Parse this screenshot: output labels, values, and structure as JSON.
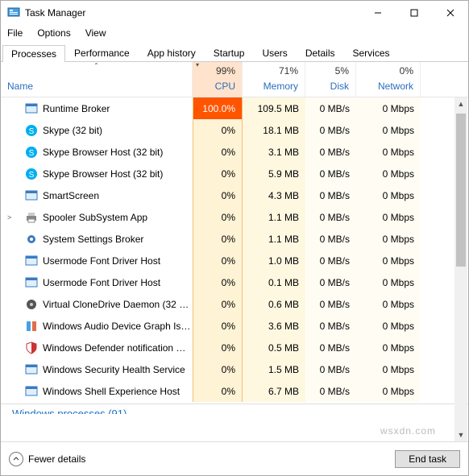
{
  "window": {
    "title": "Task Manager",
    "buttons": {
      "min": "—",
      "max": "☐",
      "close": "✕"
    }
  },
  "menu": [
    "File",
    "Options",
    "View"
  ],
  "tabs": [
    "Processes",
    "Performance",
    "App history",
    "Startup",
    "Users",
    "Details",
    "Services"
  ],
  "active_tab": 0,
  "columns": {
    "name": "Name",
    "cpu": {
      "pct": "99%",
      "label": "CPU"
    },
    "mem": {
      "pct": "71%",
      "label": "Memory"
    },
    "disk": {
      "pct": "5%",
      "label": "Disk"
    },
    "net": {
      "pct": "0%",
      "label": "Network"
    }
  },
  "sort_column": "cpu",
  "rows": [
    {
      "icon": "app",
      "name": "Runtime Broker",
      "cpu": "100.0%",
      "mem": "109.5 MB",
      "disk": "0 MB/s",
      "net": "0 Mbps",
      "hot": true
    },
    {
      "icon": "skype",
      "name": "Skype (32 bit)",
      "cpu": "0%",
      "mem": "18.1 MB",
      "disk": "0 MB/s",
      "net": "0 Mbps"
    },
    {
      "icon": "skype",
      "name": "Skype Browser Host (32 bit)",
      "cpu": "0%",
      "mem": "3.1 MB",
      "disk": "0 MB/s",
      "net": "0 Mbps"
    },
    {
      "icon": "skype",
      "name": "Skype Browser Host (32 bit)",
      "cpu": "0%",
      "mem": "5.9 MB",
      "disk": "0 MB/s",
      "net": "0 Mbps"
    },
    {
      "icon": "app",
      "name": "SmartScreen",
      "cpu": "0%",
      "mem": "4.3 MB",
      "disk": "0 MB/s",
      "net": "0 Mbps"
    },
    {
      "icon": "printer",
      "name": "Spooler SubSystem App",
      "cpu": "0%",
      "mem": "1.1 MB",
      "disk": "0 MB/s",
      "net": "0 Mbps",
      "expand": true
    },
    {
      "icon": "gear",
      "name": "System Settings Broker",
      "cpu": "0%",
      "mem": "1.1 MB",
      "disk": "0 MB/s",
      "net": "0 Mbps"
    },
    {
      "icon": "app",
      "name": "Usermode Font Driver Host",
      "cpu": "0%",
      "mem": "1.0 MB",
      "disk": "0 MB/s",
      "net": "0 Mbps"
    },
    {
      "icon": "app",
      "name": "Usermode Font Driver Host",
      "cpu": "0%",
      "mem": "0.1 MB",
      "disk": "0 MB/s",
      "net": "0 Mbps"
    },
    {
      "icon": "disc",
      "name": "Virtual CloneDrive Daemon (32 …",
      "cpu": "0%",
      "mem": "0.6 MB",
      "disk": "0 MB/s",
      "net": "0 Mbps"
    },
    {
      "icon": "audio",
      "name": "Windows Audio Device Graph Is…",
      "cpu": "0%",
      "mem": "3.6 MB",
      "disk": "0 MB/s",
      "net": "0 Mbps"
    },
    {
      "icon": "shield",
      "name": "Windows Defender notification …",
      "cpu": "0%",
      "mem": "0.5 MB",
      "disk": "0 MB/s",
      "net": "0 Mbps"
    },
    {
      "icon": "app",
      "name": "Windows Security Health Service",
      "cpu": "0%",
      "mem": "1.5 MB",
      "disk": "0 MB/s",
      "net": "0 Mbps"
    },
    {
      "icon": "app",
      "name": "Windows Shell Experience Host",
      "cpu": "0%",
      "mem": "6.7 MB",
      "disk": "0 MB/s",
      "net": "0 Mbps"
    }
  ],
  "group_footer": "Windows processes (91)",
  "footer": {
    "fewer": "Fewer details",
    "end": "End task"
  },
  "watermark": "wsxdn.com"
}
